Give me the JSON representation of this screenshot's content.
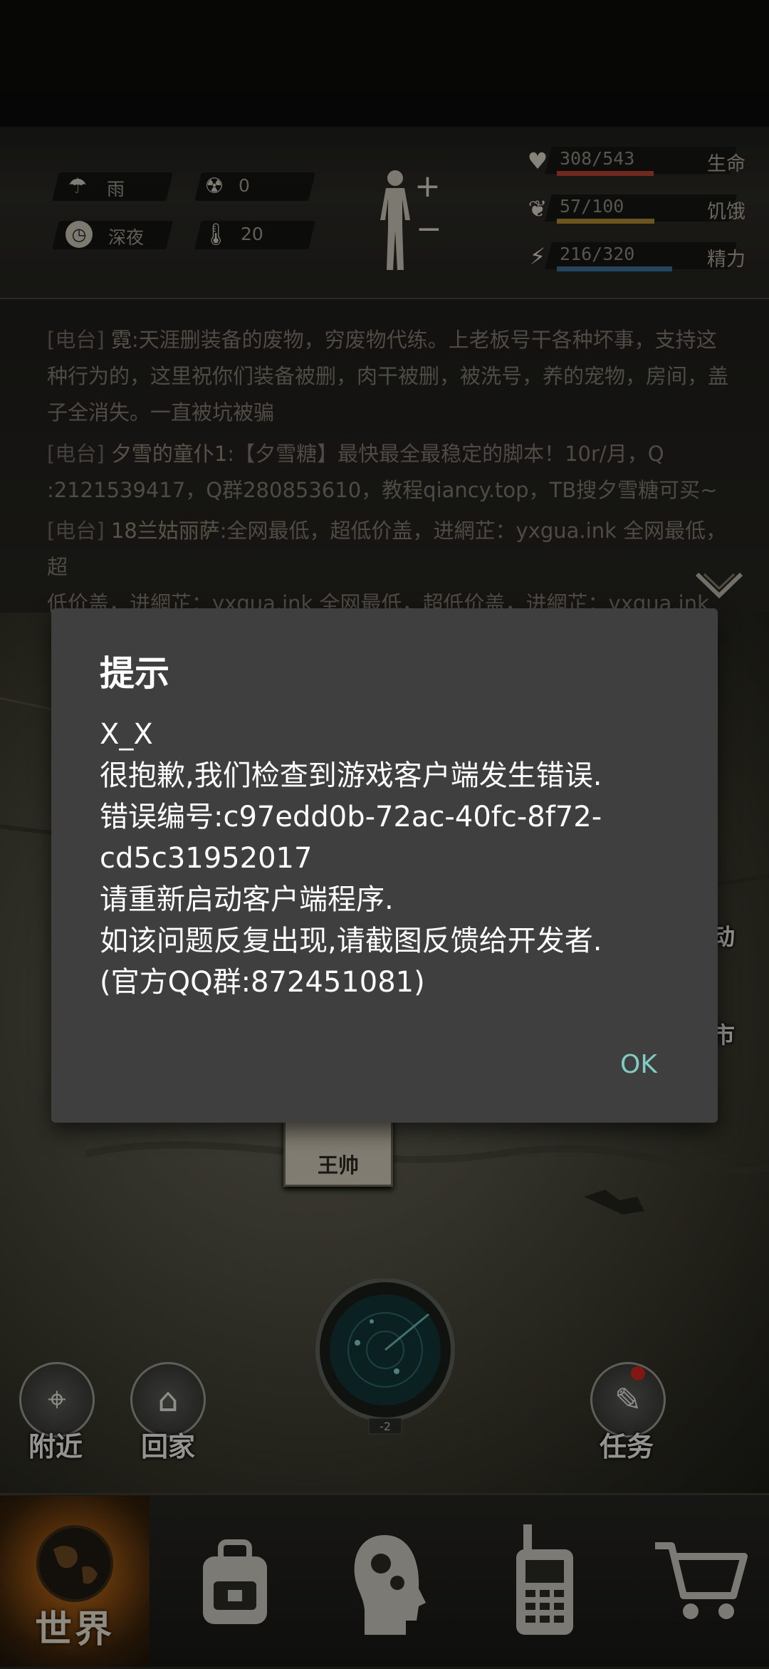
{
  "hud": {
    "weather": "雨",
    "radiation": "0",
    "time_of_day": "深夜",
    "temperature": "20",
    "health": {
      "value": "308/543",
      "label": "生命",
      "fill": 0.567,
      "color": "#b8432f"
    },
    "hunger": {
      "value": "57/100",
      "label": "饥饿",
      "fill": 0.57,
      "color": "#b08a35"
    },
    "energy": {
      "value": "216/320",
      "label": "精力",
      "fill": 0.675,
      "color": "#3b6f9c"
    }
  },
  "radio": {
    "messages": [
      {
        "tag": "[电台]",
        "sender": "霓",
        "lines": [
          "天涯删装备的废物，穷废物代练。上老板号干各种坏事，支持这",
          "种行为的，这里祝你们装备被删，肉干被删，被洗号，养的宠物，房间，盖",
          "子全消失。一直被坑被骗"
        ]
      },
      {
        "tag": "[电台]",
        "sender": "夕雪的童仆1",
        "lines": [
          "【夕雪糖】最快最全最稳定的脚本！10r/月，Q",
          ":2121539417，Q群280853610，教程qiancy.top，TB搜夕雪糖可买~"
        ]
      },
      {
        "tag": "[电台]",
        "sender": "18兰姑丽萨",
        "lines": [
          "全网最低，超低价盖，进網芷：yxgua.ink 全网最低，超",
          "低价盖，进網芷：yxgua.ink 全网最低，超低价盖，进網芷：yxgua.ink"
        ]
      }
    ]
  },
  "map": {
    "npc_name": "王帅",
    "radar_level": "-2",
    "nearby_label": "附近",
    "home_label": "回家",
    "task_label": "任务",
    "partial_label_1": "动",
    "partial_label_2": "市"
  },
  "nav": {
    "world_label": "世界"
  },
  "dialog": {
    "title": "提示",
    "lines": [
      "X_X",
      "很抱歉,我们检查到游戏客户端发生错误.",
      "错误编号:c97edd0b-72ac-40fc-8f72-",
      "cd5c31952017",
      "请重新启动客户端程序.",
      "如该问题反复出现,请截图反馈给开发者.",
      "(官方QQ群:872451081)"
    ],
    "ok_label": "OK"
  }
}
